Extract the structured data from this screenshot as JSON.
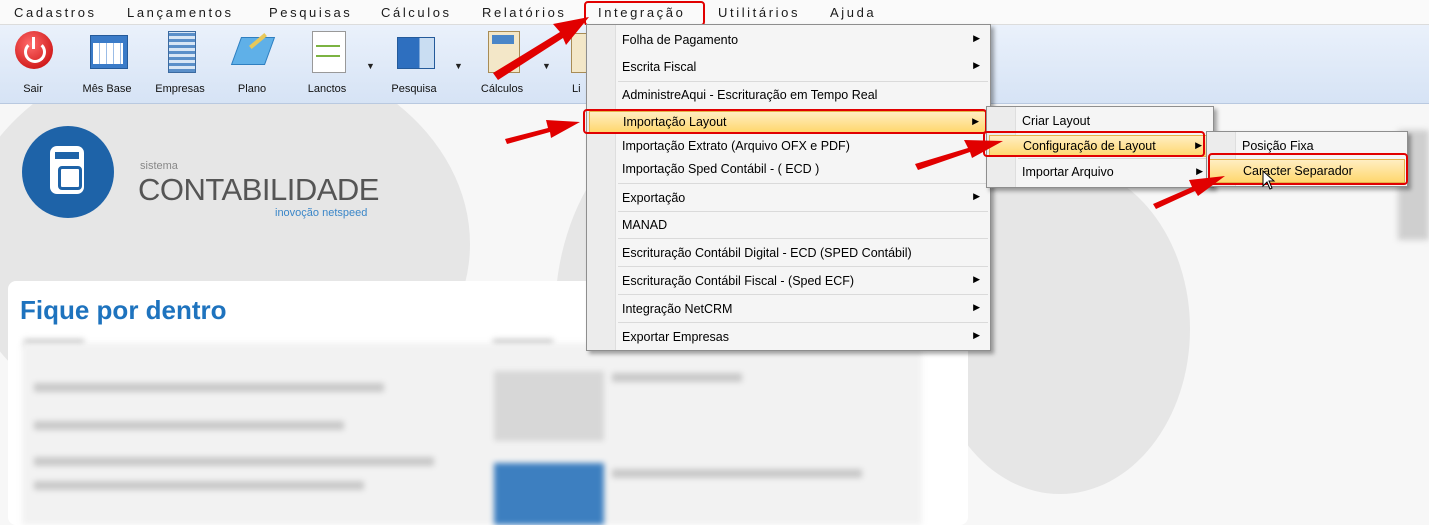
{
  "menubar": {
    "items": [
      "Cadastros",
      "Lançamentos",
      "Pesquisas",
      "Cálculos",
      "Relatórios",
      "Integração",
      "Utilitários",
      "Ajuda"
    ]
  },
  "toolbar": {
    "buttons": [
      "Sair",
      "Mês Base",
      "Empresas",
      "Plano",
      "Lanctos",
      "Pesquisa",
      "Cálculos",
      "Li"
    ]
  },
  "logo": {
    "small": "sistema",
    "name": "CONTABILIDADE",
    "tagline": "inovoção netspeed"
  },
  "panel": {
    "title": "Fique por dentro"
  },
  "menu_integracao": [
    "Folha de Pagamento",
    "Escrita Fiscal",
    "AdministreAqui - Escrituração em Tempo Real",
    "Importação Layout",
    "Importação Extrato (Arquivo OFX e PDF)",
    "Importação Sped Contábil - ( ECD )",
    "Exportação",
    "MANAD",
    "Escrituração Contábil Digital - ECD (SPED Contábil)",
    "Escrituração Contábil Fiscal - (Sped ECF)",
    "Integração NetCRM",
    "Exportar Empresas"
  ],
  "menu_importacao_layout": [
    "Criar Layout",
    "Configuração de Layout",
    "Importar Arquivo"
  ],
  "menu_configuracao": [
    "Posição Fixa",
    "Caracter Separador"
  ],
  "colors": {
    "highlight": "#ffd76e",
    "annotation": "#e10000",
    "title_blue": "#1e73be"
  }
}
